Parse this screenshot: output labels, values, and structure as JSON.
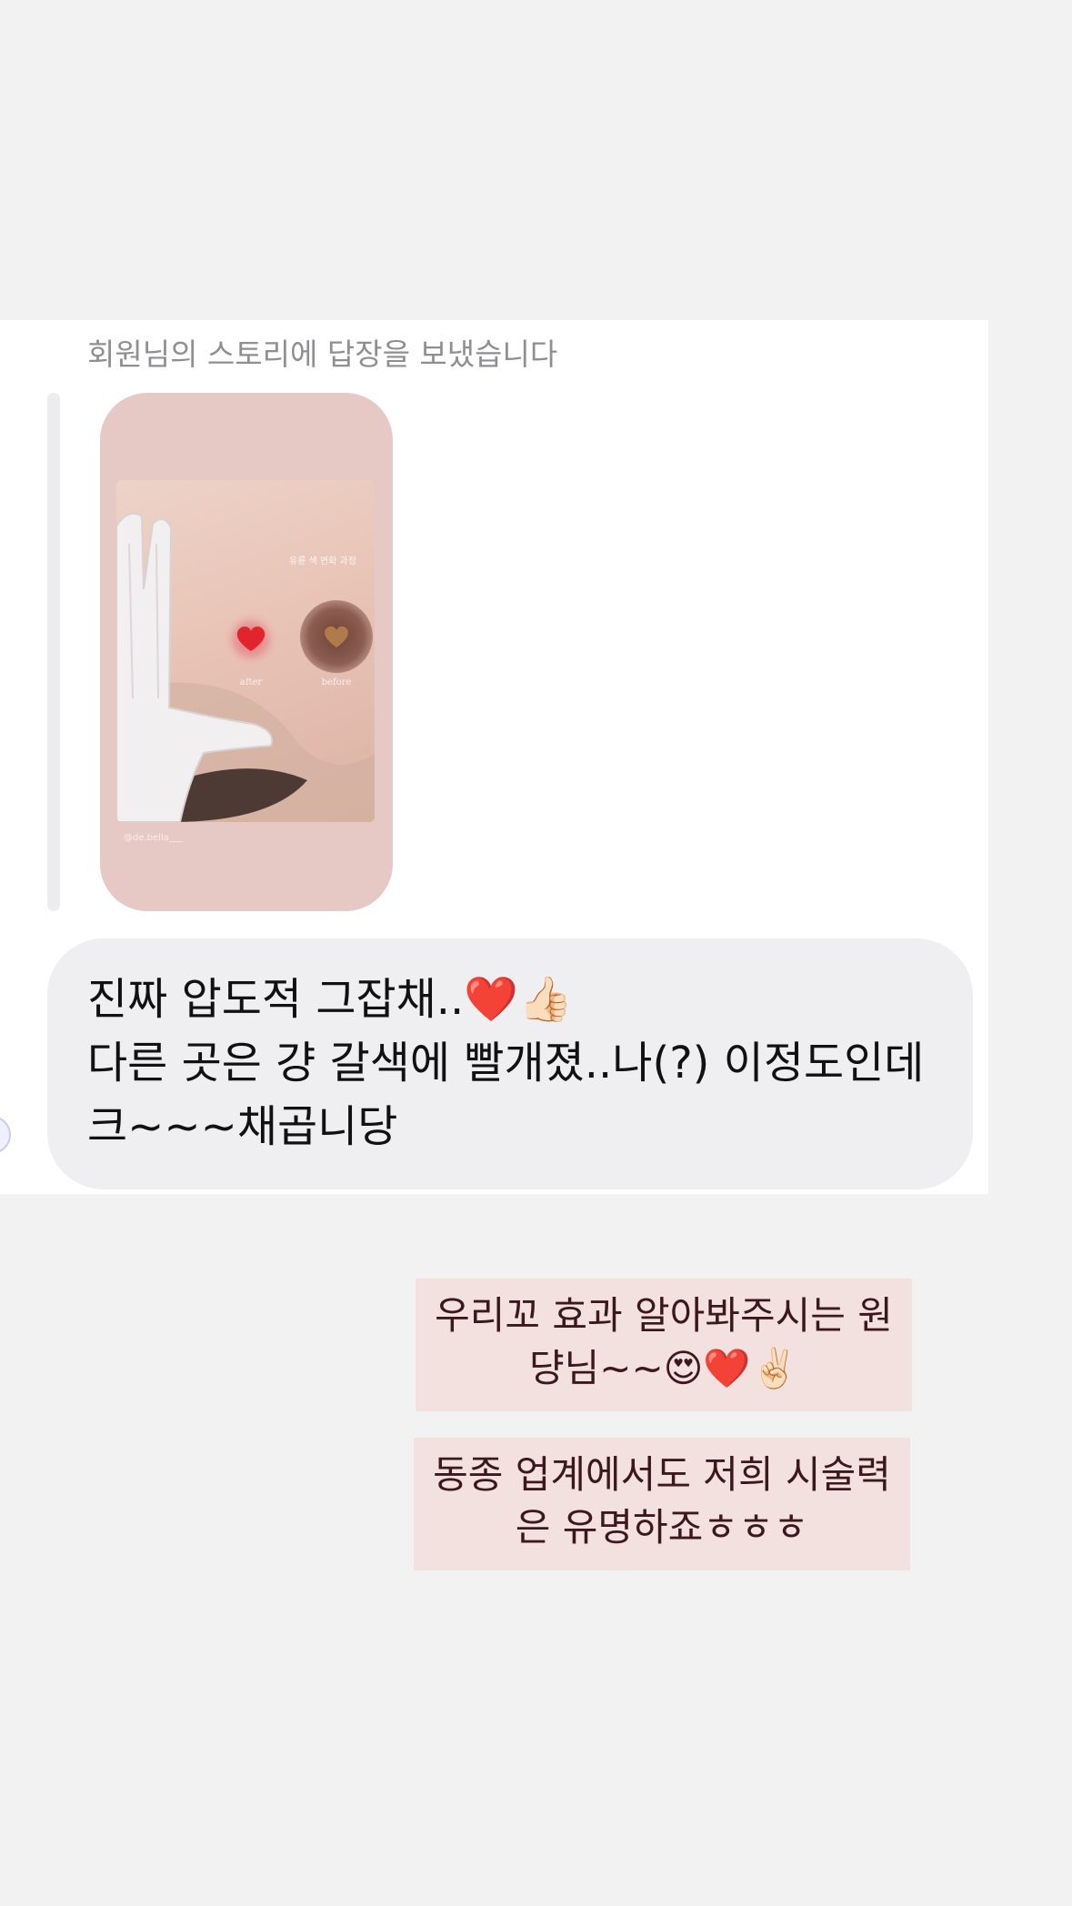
{
  "conversation": {
    "story_reply_label": "회원님의 스토리에 답장을 보냈습니다",
    "story": {
      "photo_title": "유륜 색 변화 과정",
      "after_label": "after",
      "before_label": "before",
      "handle": "@de.bella___"
    },
    "incoming_message": {
      "line_1": "진짜 압도적 그잡채..❤️👍🏻",
      "line_2": "다른 곳은 걍 갈색에 빨개졌..나(?) 이정도인데",
      "line_3": "크~~~채곱니당"
    },
    "replies": [
      {
        "line_1": "우리꼬 효과 알아봐주시는 원",
        "line_2": "댱님~~😍❤️✌🏻"
      },
      {
        "line_1": "동종 업계에서도 저희 시술력",
        "line_2": "은 유명하죠ㅎㅎㅎ"
      }
    ]
  },
  "colors": {
    "page_background": "#f2f2f3",
    "panel_background": "#ffffff",
    "incoming_bubble": "#efeff1",
    "reply_box": "#f3e1df",
    "reply_text": "#3c1818",
    "story_card": "#e6c8c4"
  }
}
